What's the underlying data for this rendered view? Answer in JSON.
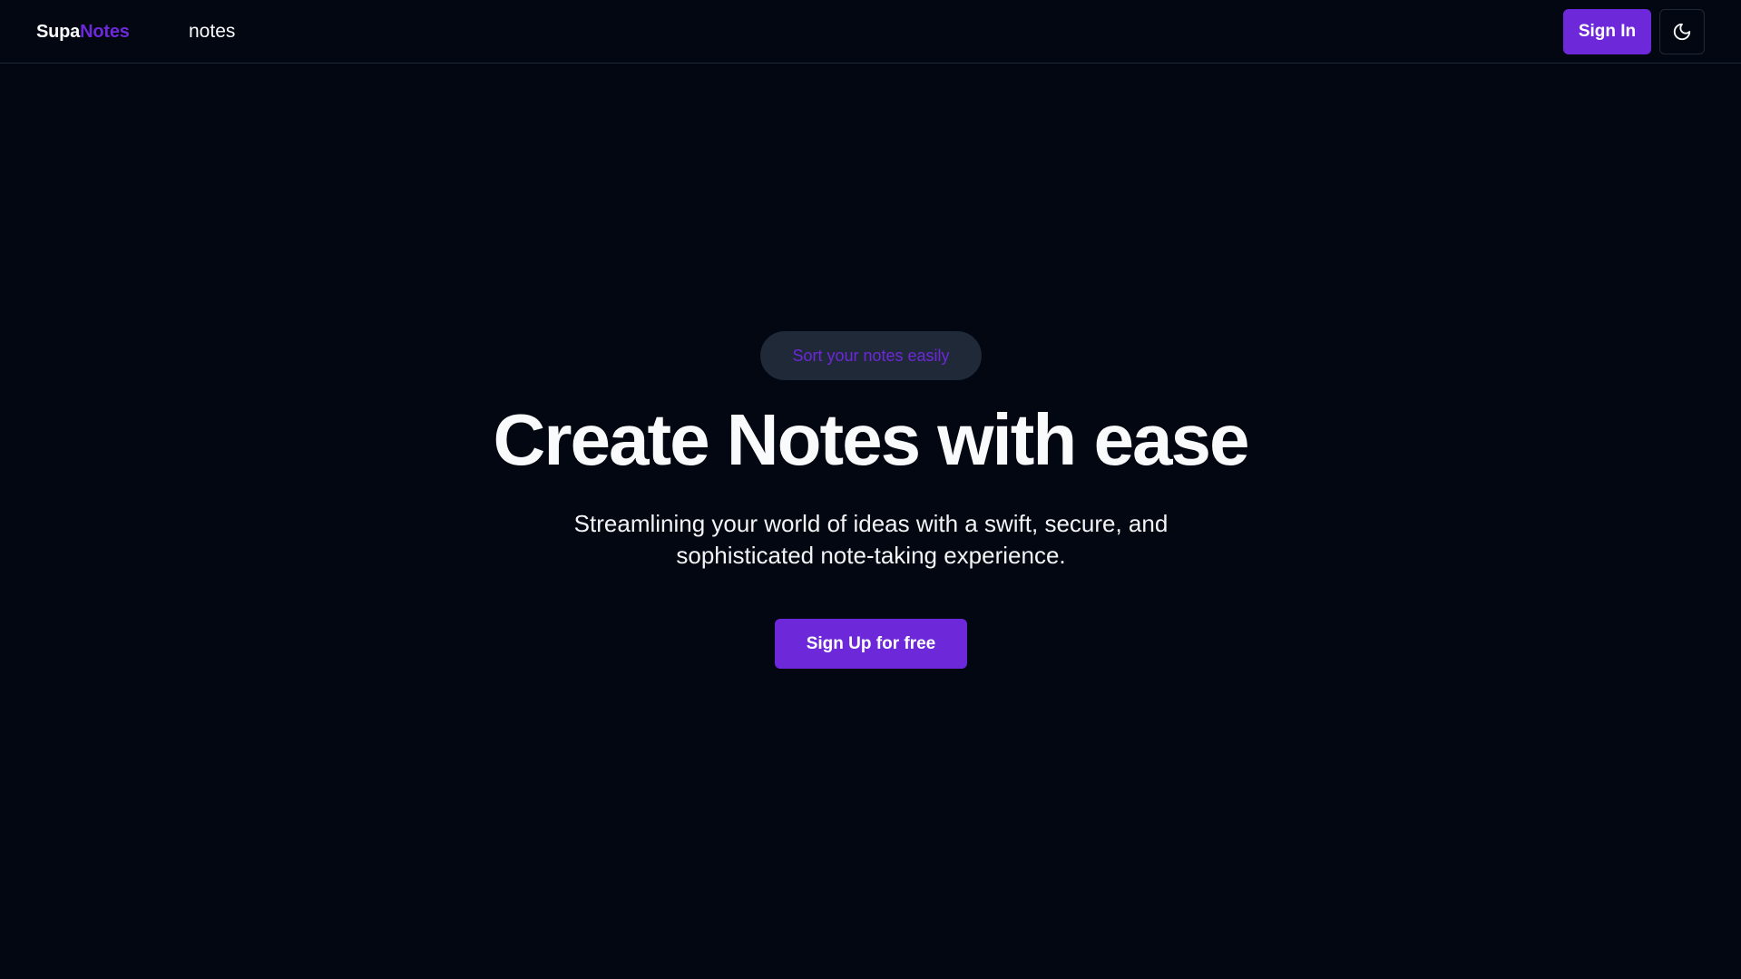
{
  "header": {
    "logo_part1": "Supa",
    "logo_part2": "Notes",
    "nav_link": "notes",
    "signin_label": "Sign In",
    "theme_icon": "moon-icon"
  },
  "hero": {
    "badge": "Sort your notes easily",
    "title": "Create Notes with ease",
    "subtitle": "Streamlining your world of ideas with a swift, secure, and sophisticated note-taking experience.",
    "cta_label": "Sign Up for free"
  },
  "colors": {
    "background": "#030712",
    "accent": "#6d28d9",
    "badge_bg": "#1f2937",
    "text": "#f9fafb"
  }
}
